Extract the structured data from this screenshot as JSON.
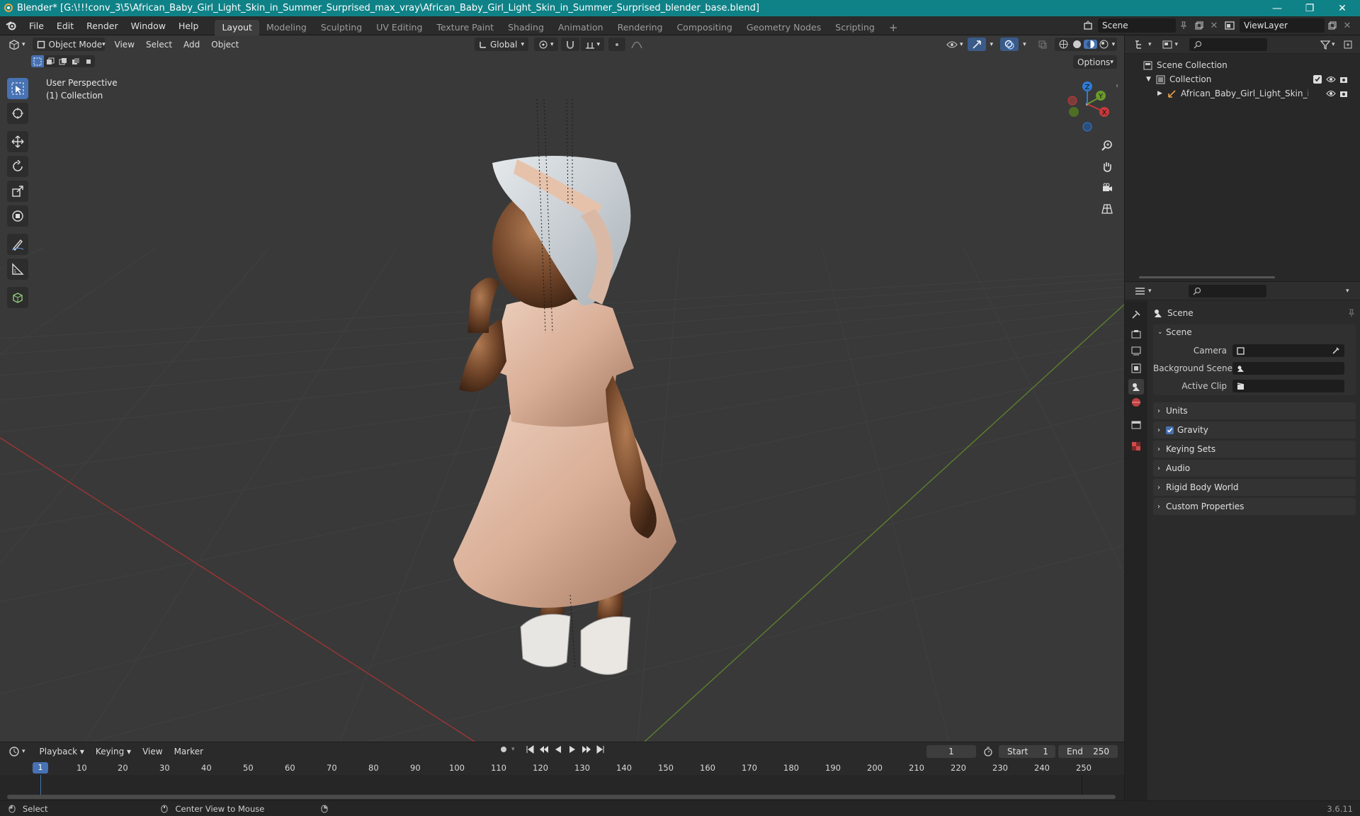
{
  "window": {
    "title": "Blender* [G:\\!!!conv_3\\5\\African_Baby_Girl_Light_Skin_in_Summer_Surprised_max_vray\\African_Baby_Girl_Light_Skin_in_Summer_Surprised_blender_base.blend]",
    "minimize": "—",
    "maximize": "❐",
    "close": "✕"
  },
  "menu": [
    "File",
    "Edit",
    "Render",
    "Window",
    "Help"
  ],
  "workspaces": [
    "Layout",
    "Modeling",
    "Sculpting",
    "UV Editing",
    "Texture Paint",
    "Shading",
    "Animation",
    "Rendering",
    "Compositing",
    "Geometry Nodes",
    "Scripting"
  ],
  "active_workspace": "Layout",
  "add_workspace": "+",
  "scene_field": "Scene",
  "viewlayer_field": "ViewLayer",
  "viewport": {
    "mode": "Object Mode",
    "menus": [
      "View",
      "Select",
      "Add",
      "Object"
    ],
    "transform_orientation": "Global",
    "options": "Options",
    "overlay_text_1": "User Perspective",
    "overlay_text_2": "(1) Collection",
    "gizmo_axes": {
      "x": "X",
      "y": "Y",
      "z": "Z"
    }
  },
  "outliner": {
    "scene_collection": "Scene Collection",
    "collection": "Collection",
    "object": "African_Baby_Girl_Light_Skin_in_Su"
  },
  "properties": {
    "header": "Scene",
    "panel": "Scene",
    "camera_label": "Camera",
    "bg_scene_label": "Background Scene",
    "active_clip_label": "Active Clip",
    "sections": [
      "Units",
      "Gravity",
      "Keying Sets",
      "Audio",
      "Rigid Body World",
      "Custom Properties"
    ],
    "gravity_checked": true
  },
  "timeline": {
    "menus": [
      "Playback",
      "Keying",
      "View",
      "Marker"
    ],
    "current_frame": "1",
    "start_label": "Start",
    "start_value": "1",
    "end_label": "End",
    "end_value": "250",
    "ruler": [
      "1",
      "10",
      "20",
      "30",
      "40",
      "50",
      "60",
      "70",
      "80",
      "90",
      "100",
      "110",
      "120",
      "130",
      "140",
      "150",
      "160",
      "170",
      "180",
      "190",
      "200",
      "210",
      "220",
      "230",
      "240",
      "250"
    ]
  },
  "statusbar": {
    "select": "Select",
    "center_view": "Center View to Mouse",
    "version": "3.6.11"
  },
  "colors": {
    "accent": "#4772b3",
    "titlebar": "#0f8287",
    "x_axis": "#c53a3a",
    "y_axis": "#6a9a2c",
    "z_axis": "#2f7bd6",
    "playhead": "#4772b3"
  }
}
